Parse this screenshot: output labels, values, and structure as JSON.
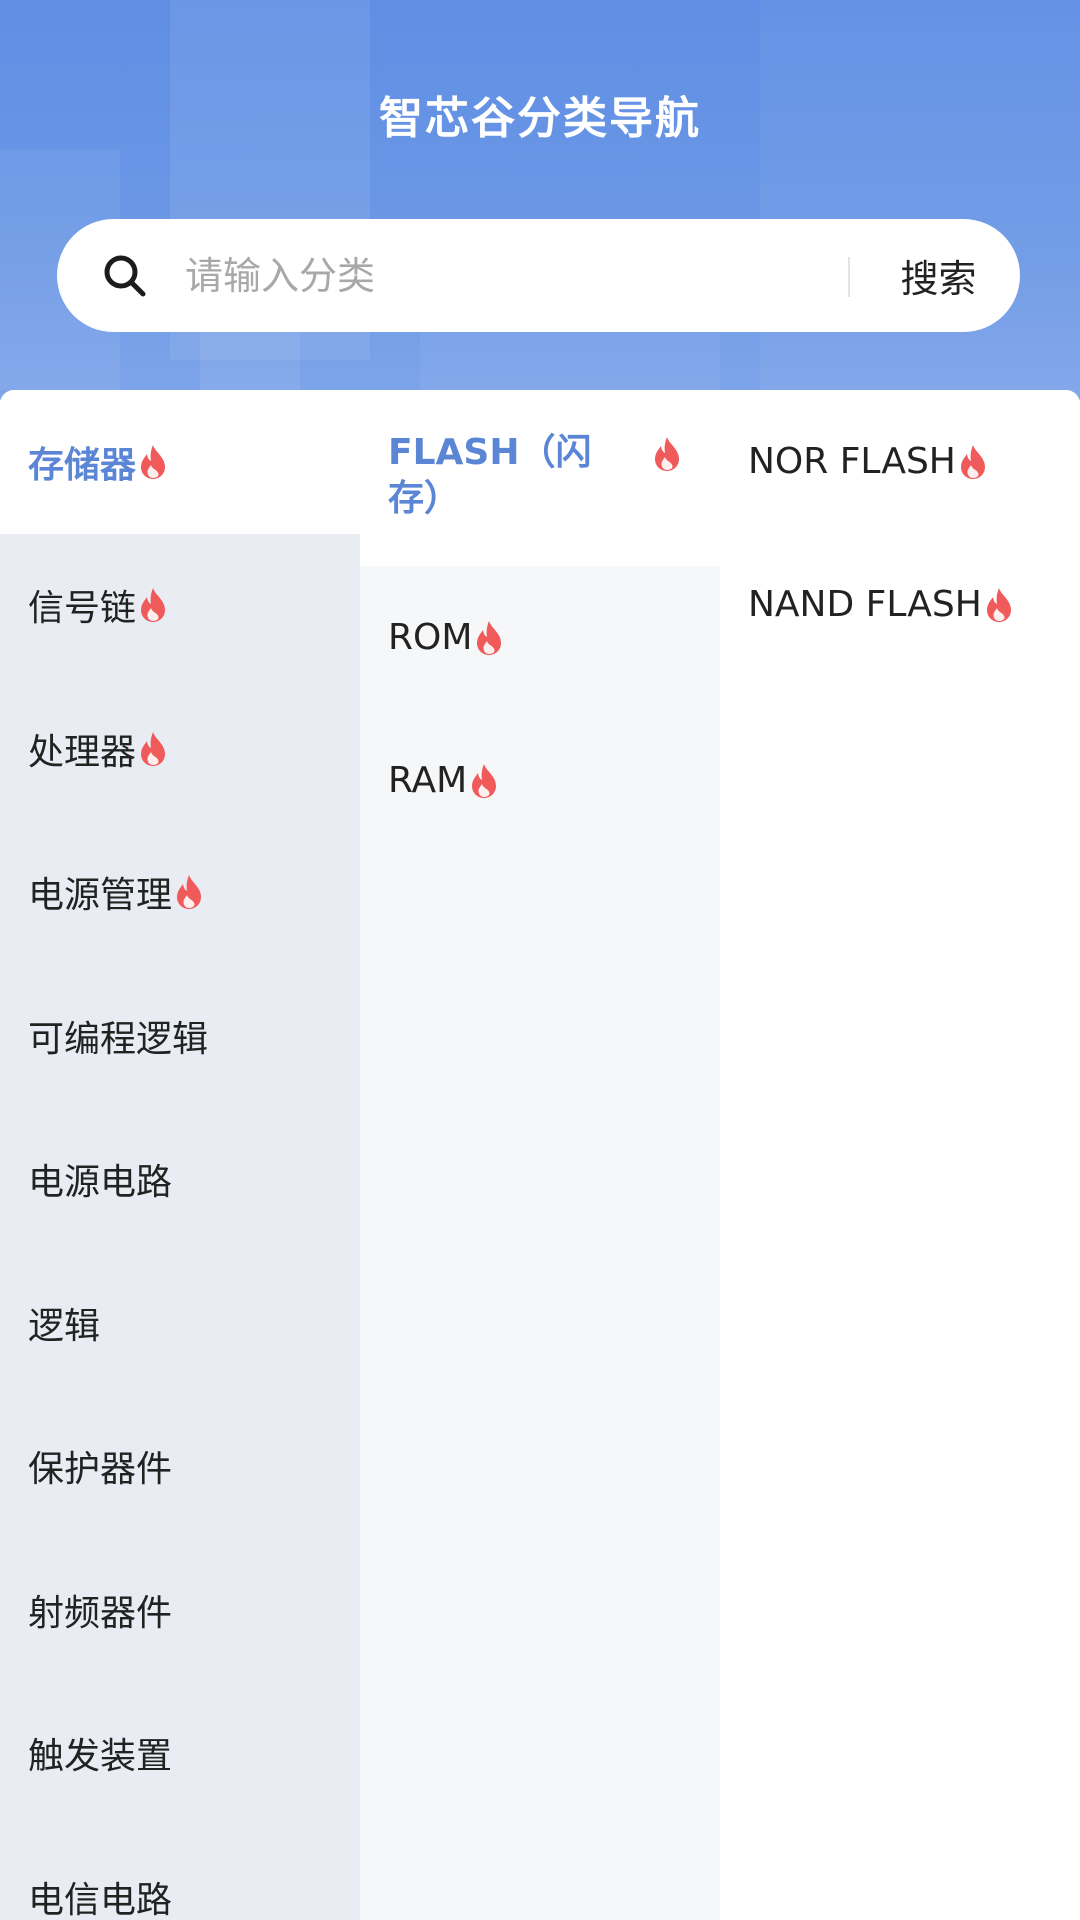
{
  "header": {
    "title": "智芯谷分类导航"
  },
  "search": {
    "placeholder": "请输入分类",
    "button_label": "搜索",
    "icon": "search-icon"
  },
  "colors": {
    "accent": "#5b86d6",
    "hot": "#f05a5a",
    "header_bg": "#6b97e5",
    "col1_bg": "#e9edf3",
    "col2_bg": "#f6f7f9"
  },
  "level1": [
    {
      "label": "存储器",
      "hot": true,
      "active": true
    },
    {
      "label": "信号链",
      "hot": true,
      "active": false
    },
    {
      "label": "处理器",
      "hot": true,
      "active": false
    },
    {
      "label": "电源管理",
      "hot": true,
      "active": false
    },
    {
      "label": "可编程逻辑",
      "hot": false,
      "active": false
    },
    {
      "label": "电源电路",
      "hot": false,
      "active": false
    },
    {
      "label": "逻辑",
      "hot": false,
      "active": false
    },
    {
      "label": "保护器件",
      "hot": false,
      "active": false
    },
    {
      "label": "射频器件",
      "hot": false,
      "active": false
    },
    {
      "label": "触发装置",
      "hot": false,
      "active": false
    },
    {
      "label": "电信电路",
      "hot": false,
      "active": false
    }
  ],
  "level2": [
    {
      "label": "FLASH（闪存）",
      "hot": true,
      "active": true
    },
    {
      "label": "ROM",
      "hot": true,
      "active": false
    },
    {
      "label": "RAM",
      "hot": true,
      "active": false
    }
  ],
  "level3": [
    {
      "label": "NOR FLASH",
      "hot": true
    },
    {
      "label": "NAND FLASH",
      "hot": true
    }
  ]
}
